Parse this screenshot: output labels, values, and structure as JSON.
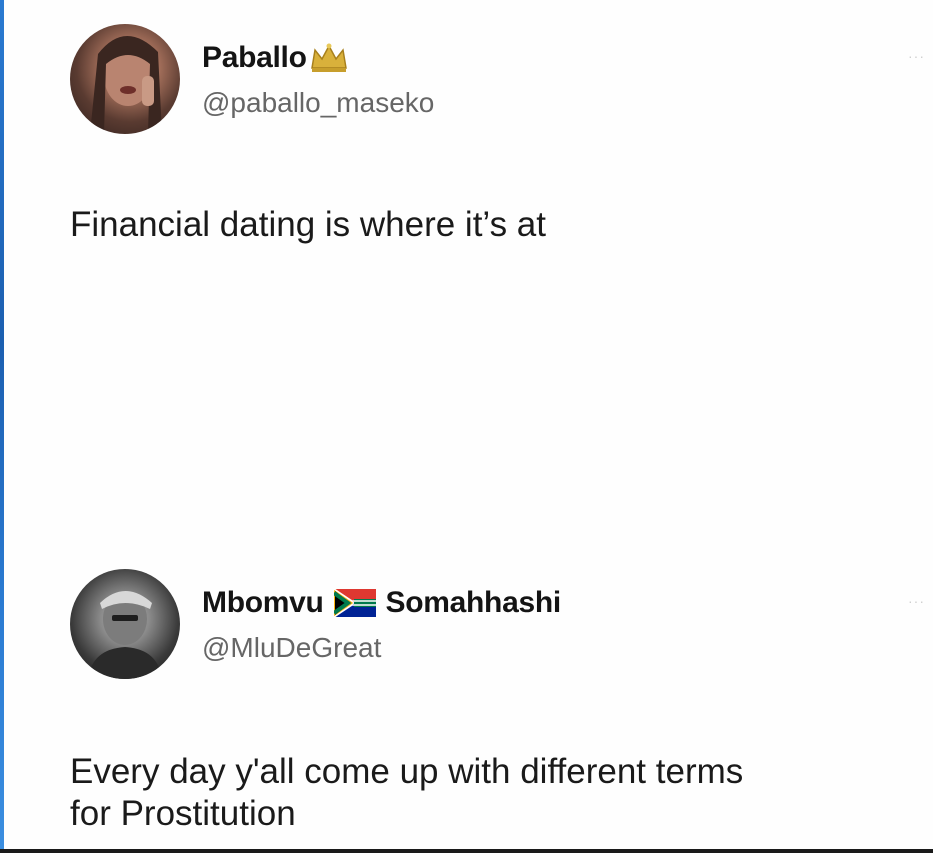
{
  "tweets": [
    {
      "display_name": "Paballo",
      "name_suffix_icon": "crown-icon",
      "handle": "@paballo_maseko",
      "more_label": "···",
      "text": "Financial dating is where it’s at"
    },
    {
      "display_name_first": "Mbomvu",
      "name_flag_icon": "south-africa-flag-icon",
      "display_name_last": "Somahhashi",
      "handle": "@MluDeGreat",
      "more_label": "···",
      "text_line_1": "Every day y'all come up with different terms",
      "text_line_2": "for Prostitution"
    }
  ],
  "colors": {
    "name": "#141414",
    "handle": "#666666",
    "text": "#1a1a1a",
    "edge_accent": "#2a7ad1"
  }
}
